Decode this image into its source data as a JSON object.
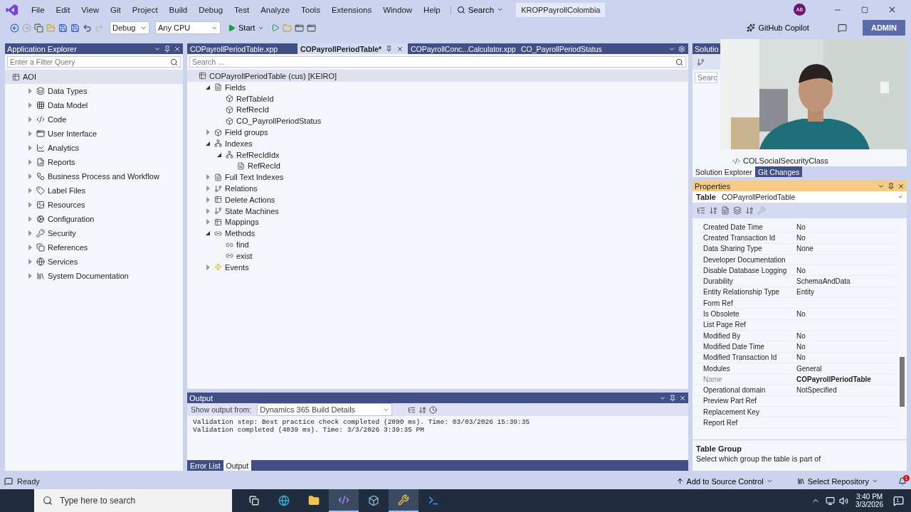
{
  "title_bar": {
    "menu": [
      "File",
      "Edit",
      "View",
      "Git",
      "Project",
      "Build",
      "Debug",
      "Test",
      "Analyze",
      "Tools",
      "Extensions",
      "Window",
      "Help"
    ],
    "search": "Search",
    "solution": "KROPPayrollColombia",
    "avatar": "AB"
  },
  "toolbar": {
    "configuration": "Debug",
    "platform": "Any CPU",
    "start": "Start",
    "copilot": "GitHub Copilot",
    "admin": "ADMIN"
  },
  "app_explorer": {
    "title": "Application Explorer",
    "filter_placeholder": "Enter a Filter Query",
    "root": "AOI",
    "items": [
      {
        "label": "Data Types",
        "expanded": false
      },
      {
        "label": "Data Model",
        "expanded": false
      },
      {
        "label": "Code",
        "expanded": false
      },
      {
        "label": "User Interface",
        "expanded": false
      },
      {
        "label": "Analytics",
        "expanded": false
      },
      {
        "label": "Reports",
        "expanded": false
      },
      {
        "label": "Business Process and Workflow",
        "expanded": false
      },
      {
        "label": "Label Files",
        "expanded": false
      },
      {
        "label": "Resources",
        "expanded": false
      },
      {
        "label": "Configuration",
        "expanded": false
      },
      {
        "label": "Security",
        "expanded": false
      },
      {
        "label": "References",
        "expanded": false
      },
      {
        "label": "Services",
        "expanded": false
      },
      {
        "label": "System Documentation",
        "expanded": false
      }
    ]
  },
  "editor": {
    "tabs": [
      {
        "label": "COPayrollPeriodTable.xpp",
        "selected": false
      },
      {
        "label": "COPayrollPeriodTable*",
        "selected": true
      },
      {
        "label": "COPayrollConc...Calculator.xpp",
        "selected": false
      },
      {
        "label": "CO_PayrollPeriodStatus",
        "selected": false
      }
    ],
    "search_placeholder": "Search ...",
    "tree": {
      "label": "COPayrollPeriodTable (cus) [KEIRO]",
      "kind": "table",
      "children": [
        {
          "label": "Fields",
          "kind": "folder",
          "expanded": true,
          "children": [
            {
              "label": "RefTableId",
              "kind": "field"
            },
            {
              "label": "RefRecId",
              "kind": "field"
            },
            {
              "label": "CO_PayrollPeriodStatus",
              "kind": "field"
            }
          ]
        },
        {
          "label": "Field groups",
          "kind": "field",
          "expanded": false
        },
        {
          "label": "Indexes",
          "kind": "index",
          "expanded": true,
          "children": [
            {
              "label": "RefRecIdIdx",
              "kind": "index",
              "expanded": true,
              "children": [
                {
                  "label": "RefRecId",
                  "kind": "folder"
                }
              ]
            }
          ]
        },
        {
          "label": "Full Text Indexes",
          "kind": "folder",
          "expanded": false
        },
        {
          "label": "Relations",
          "kind": "relation",
          "expanded": false
        },
        {
          "label": "Delete Actions",
          "kind": "table",
          "expanded": false
        },
        {
          "label": "State Machines",
          "kind": "relation",
          "expanded": false
        },
        {
          "label": "Mappings",
          "kind": "table",
          "expanded": false
        },
        {
          "label": "Methods",
          "kind": "method",
          "expanded": true,
          "children": [
            {
              "label": "find",
              "kind": "method"
            },
            {
              "label": "exist",
              "kind": "method"
            }
          ]
        },
        {
          "label": "Events",
          "kind": "event",
          "expanded": false
        }
      ]
    }
  },
  "solution_explorer": {
    "title": "Solutio",
    "search": "Searc",
    "item": "COLSocialSecurityClass",
    "tabs": [
      {
        "label": "Solution Explorer",
        "selected": true
      },
      {
        "label": "Git Changes",
        "selected": false
      }
    ]
  },
  "properties": {
    "title": "Properties",
    "object_type": "Table",
    "object_name": "COPayrollPeriodTable",
    "rows": [
      {
        "name": "Created Date Time",
        "value": "No",
        "read_only": false
      },
      {
        "name": "Created Transaction Id",
        "value": "No",
        "read_only": false
      },
      {
        "name": "Data Sharing Type",
        "value": "None",
        "read_only": false
      },
      {
        "name": "Developer Documentation",
        "read_only": false
      },
      {
        "name": "Disable Database Logging",
        "value": "No",
        "read_only": false
      },
      {
        "name": "Durability",
        "value": "SchemaAndData",
        "read_only": false
      },
      {
        "name": "Entity Relationship Type",
        "value": "Entity",
        "read_only": false
      },
      {
        "name": "Form Ref",
        "read_only": false
      },
      {
        "name": "Is Obsolete",
        "value": "No",
        "read_only": false
      },
      {
        "name": "List Page Ref",
        "read_only": false
      },
      {
        "name": "Modified By",
        "value": "No",
        "read_only": false
      },
      {
        "name": "Modified Date Time",
        "value": "No",
        "read_only": false
      },
      {
        "name": "Modified Transaction Id",
        "value": "No",
        "read_only": false
      },
      {
        "name": "Modules",
        "value": "General",
        "read_only": false
      },
      {
        "name": "Name",
        "value": "COPayrollPeriodTable",
        "read_only": true
      },
      {
        "name": "Operational domain",
        "value": "NotSpecified",
        "read_only": false
      },
      {
        "name": "Preview Part Ref",
        "read_only": false
      },
      {
        "name": "Replacement Key",
        "read_only": false
      },
      {
        "name": "Report Ref",
        "read_only": false
      }
    ],
    "description_title": "Table Group",
    "description": "Select which group the table is part of"
  },
  "output": {
    "title": "Output",
    "source_label": "Show output from:",
    "source": "Dynamics 365 Build Details",
    "lines": [
      "Validation step: Best practice check completed (2090 ms). Time: 03/03/2026 15:39:35",
      "Validation completed (4039 ms). Time: 3/3/2026 3:39:35 PM"
    ],
    "tabs": [
      {
        "label": "Error List",
        "selected": false
      },
      {
        "label": "Output",
        "selected": true
      }
    ]
  },
  "status_bar": {
    "status": "Ready",
    "source_control": "Add to Source Control",
    "repository": "Select Repository",
    "notifications": "1"
  },
  "taskbar": {
    "search_placeholder": "Type here to search",
    "time": "3:40 PM",
    "date": "3/3/2026",
    "notifications": "1"
  }
}
